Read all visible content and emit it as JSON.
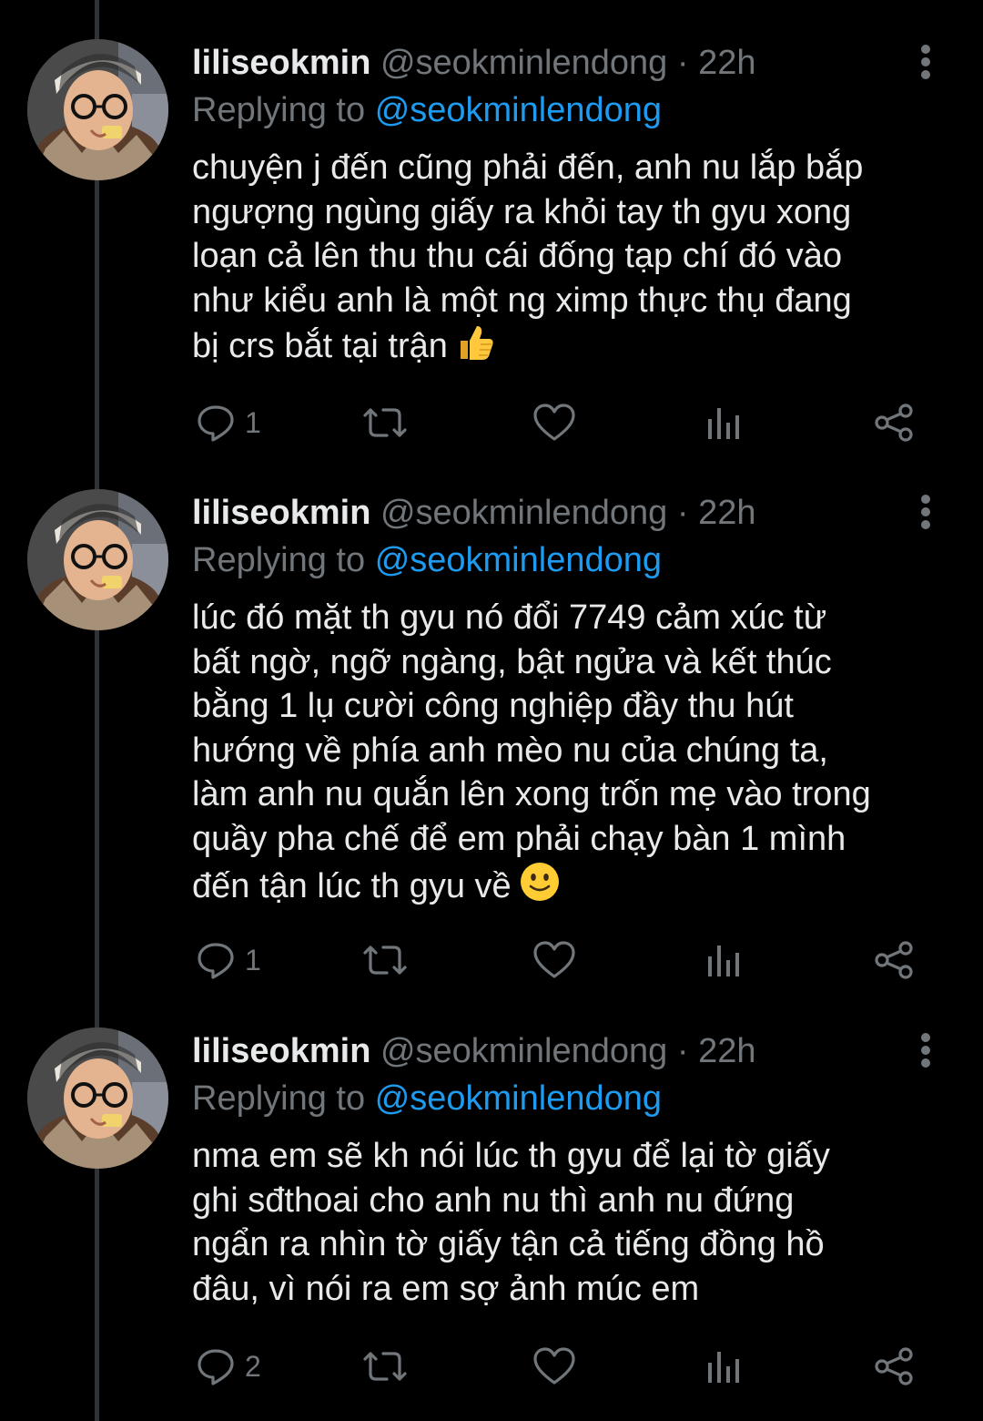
{
  "colors": {
    "background": "#000000",
    "text_primary": "#e7e9ea",
    "text_secondary": "#71767b",
    "accent": "#1d9bf0",
    "thread_line": "#2f3336"
  },
  "tweets": [
    {
      "author_name": "liliseokmin",
      "author_handle": "@seokminlendong",
      "separator": "·",
      "time": "22h",
      "replying_prefix": "Replying to",
      "replying_to": "@seokminlendong",
      "text_lines": [
        "chuyện j đến cũng phải đến, anh nu lắp bắp",
        "ngượng ngùng giấy ra khỏi tay th gyu xong",
        "loạn cả lên thu thu cái đống tạp chí đó vào",
        "như kiểu anh là một ng ximp thực thụ đang",
        "bị crs bắt tại trận"
      ],
      "emoji": "thumbs-up-emoji",
      "reply_count": "1",
      "retweet_count": "",
      "like_count": ""
    },
    {
      "author_name": "liliseokmin",
      "author_handle": "@seokminlendong",
      "separator": "·",
      "time": "22h",
      "replying_prefix": "Replying to",
      "replying_to": "@seokminlendong",
      "text_lines": [
        "lúc đó mặt th gyu nó đổi 7749 cảm xúc từ",
        "bất ngờ, ngỡ ngàng, bật ngửa và kết thúc",
        "bằng 1 lụ cười công nghiệp đầy thu hút",
        "hướng về phía anh mèo nu của chúng ta,",
        "làm anh nu quắn lên xong trốn mẹ vào trong",
        "quầy pha chế để em phải chạy bàn 1 mình",
        "đến tận lúc th gyu về"
      ],
      "emoji": "slightly-smiling-face-emoji",
      "reply_count": "1",
      "retweet_count": "",
      "like_count": ""
    },
    {
      "author_name": "liliseokmin",
      "author_handle": "@seokminlendong",
      "separator": "·",
      "time": "22h",
      "replying_prefix": "Replying to",
      "replying_to": "@seokminlendong",
      "text_lines": [
        "nma em sẽ kh nói lúc th gyu để lại tờ giấy",
        "ghi sđthoai cho anh nu thì anh nu đứng",
        "ngẩn ra nhìn tờ giấy tận cả tiếng đồng hồ",
        "đâu, vì nói ra em sợ ảnh múc em"
      ],
      "emoji": "",
      "reply_count": "2",
      "retweet_count": "",
      "like_count": ""
    }
  ],
  "icons": {
    "reply": "reply-icon",
    "retweet": "retweet-icon",
    "like": "heart-icon",
    "views": "analytics-icon",
    "share": "share-icon",
    "more": "more-vertical-icon"
  }
}
